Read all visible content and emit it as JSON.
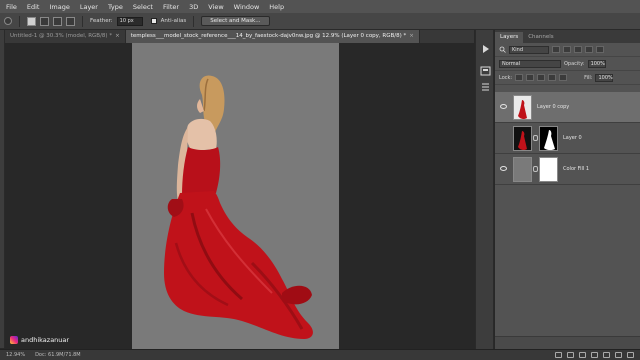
{
  "menu": [
    "File",
    "Edit",
    "Image",
    "Layer",
    "Type",
    "Select",
    "Filter",
    "3D",
    "View",
    "Window",
    "Help"
  ],
  "options": {
    "feather_label": "Feather:",
    "feather_value": "10 px",
    "antialias_label": "Anti-alias",
    "select_mask_button": "Select and Mask..."
  },
  "tabs": [
    {
      "label": "Untitled-1 @ 30.3% (model, RGB/8) *"
    },
    {
      "label": "templess___model_stock_reference___14_by_faestock-dajv0nw.jpg @ 12.9% (Layer 0 copy, RGB/8) *"
    }
  ],
  "panel": {
    "tabs": [
      "Layers",
      "Channels"
    ],
    "kind_label": "Kind",
    "blend_mode": "Normal",
    "opacity_label": "Opacity:",
    "opacity_value": "100%",
    "lock_label": "Lock:",
    "fill_label": "Fill:",
    "fill_value": "100%",
    "layers": [
      {
        "name": "Layer 0 copy",
        "visible": true,
        "selected": true
      },
      {
        "name": "Layer 0",
        "visible": false,
        "selected": false
      },
      {
        "name": "Color Fill 1",
        "visible": true,
        "selected": false
      }
    ]
  },
  "status": {
    "zoom": "12.94%",
    "doc": "Doc: 61.9M/71.8M"
  },
  "watermark": "andhikazanuar",
  "colors": {
    "dress": "#c0121a",
    "canvas_bg": "#7a7a7a",
    "panel_bg": "#535353"
  }
}
